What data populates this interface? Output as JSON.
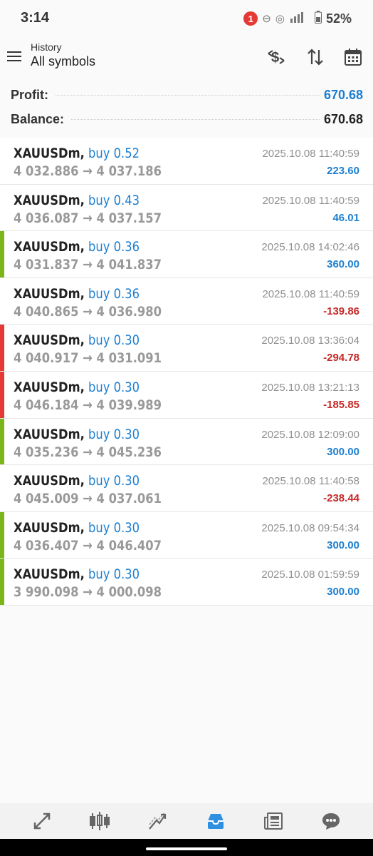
{
  "status_bar": {
    "time": "3:14",
    "notification_count": "1",
    "battery": "52%",
    "icons": [
      "dnd-icon",
      "hotspot-icon",
      "wifi-icon",
      "signal-icon",
      "battery-icon"
    ]
  },
  "header": {
    "section": "History",
    "title": "All symbols",
    "tools": [
      "currency-filter-icon",
      "sort-icon",
      "calendar-icon"
    ]
  },
  "summary": {
    "profit_label": "Profit:",
    "profit_value": "670.68",
    "balance_label": "Balance:",
    "balance_value": "670.68"
  },
  "colors": {
    "buy_blue": "#1c7fd1",
    "loss_red": "#c62828",
    "win_marker": "#7cb518",
    "loss_marker": "#e53935",
    "active_nav": "#2f8fe0"
  },
  "deals": [
    {
      "symbol": "XAUUSDm,",
      "side": "buy 0.52",
      "prices": "4 032.886 → 4 037.186",
      "time": "2025.10.08 11:40:59",
      "profit": "223.60",
      "marker": "none"
    },
    {
      "symbol": "XAUUSDm,",
      "side": "buy 0.43",
      "prices": "4 036.087 → 4 037.157",
      "time": "2025.10.08 11:40:59",
      "profit": "46.01",
      "marker": "none"
    },
    {
      "symbol": "XAUUSDm,",
      "side": "buy 0.36",
      "prices": "4 031.837 → 4 041.837",
      "time": "2025.10.08 14:02:46",
      "profit": "360.00",
      "marker": "green"
    },
    {
      "symbol": "XAUUSDm,",
      "side": "buy 0.36",
      "prices": "4 040.865 → 4 036.980",
      "time": "2025.10.08 11:40:59",
      "profit": "-139.86",
      "marker": "none"
    },
    {
      "symbol": "XAUUSDm,",
      "side": "buy 0.30",
      "prices": "4 040.917 → 4 031.091",
      "time": "2025.10.08 13:36:04",
      "profit": "-294.78",
      "marker": "red"
    },
    {
      "symbol": "XAUUSDm,",
      "side": "buy 0.30",
      "prices": "4 046.184 → 4 039.989",
      "time": "2025.10.08 13:21:13",
      "profit": "-185.85",
      "marker": "red"
    },
    {
      "symbol": "XAUUSDm,",
      "side": "buy 0.30",
      "prices": "4 035.236 → 4 045.236",
      "time": "2025.10.08 12:09:00",
      "profit": "300.00",
      "marker": "green"
    },
    {
      "symbol": "XAUUSDm,",
      "side": "buy 0.30",
      "prices": "4 045.009 → 4 037.061",
      "time": "2025.10.08 11:40:58",
      "profit": "-238.44",
      "marker": "none"
    },
    {
      "symbol": "XAUUSDm,",
      "side": "buy 0.30",
      "prices": "4 036.407 → 4 046.407",
      "time": "2025.10.08 09:54:34",
      "profit": "300.00",
      "marker": "green"
    },
    {
      "symbol": "XAUUSDm,",
      "side": "buy 0.30",
      "prices": "3 990.098 → 4 000.098",
      "time": "2025.10.08 01:59:59",
      "profit": "300.00",
      "marker": "green"
    }
  ],
  "bottom_nav": [
    {
      "name": "quotes",
      "icon": "quotes-icon",
      "active": false
    },
    {
      "name": "chart",
      "icon": "candlestick-icon",
      "active": false
    },
    {
      "name": "trade",
      "icon": "trade-icon",
      "active": false
    },
    {
      "name": "history",
      "icon": "history-inbox-icon",
      "active": true
    },
    {
      "name": "news",
      "icon": "news-icon",
      "active": false
    },
    {
      "name": "messages",
      "icon": "chat-icon",
      "active": false
    }
  ]
}
